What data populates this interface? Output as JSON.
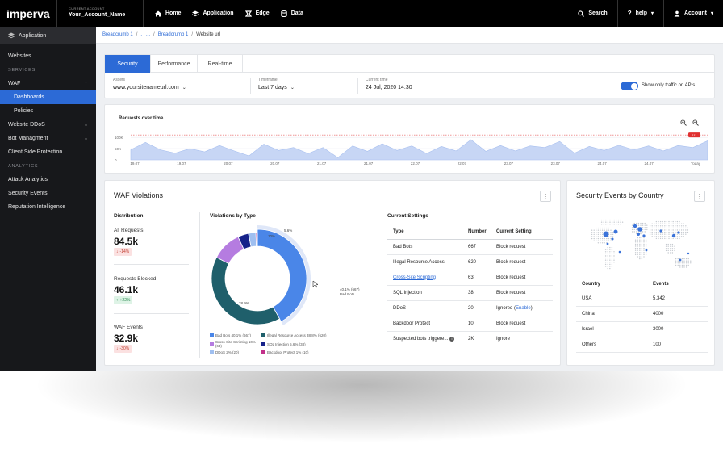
{
  "topbar": {
    "logo": "imperva",
    "account_label": "CURRENT ACCOUNT",
    "account_name": "Your_Account_Name",
    "nav": [
      {
        "label": "Home",
        "icon": "home-icon"
      },
      {
        "label": "Application",
        "icon": "layers-icon"
      },
      {
        "label": "Edge",
        "icon": "edge-icon"
      },
      {
        "label": "Data",
        "icon": "database-icon"
      }
    ],
    "search_label": "Search",
    "help_label": "help",
    "account_menu_label": "Account"
  },
  "sidebar": {
    "app_label": "Application",
    "websites": "Websites",
    "services_header": "SERVICES",
    "waf": "WAF",
    "dashboards": "Dashboards",
    "policies": "Policies",
    "website_ddos": "Website DDoS",
    "bot_management": "Bot Managment",
    "client_side": "Client Side Protection",
    "analytics_header": "ANALYTICS",
    "attack_analytics": "Attack Analytics",
    "security_events": "Security Events",
    "reputation": "Reputation Intelligence"
  },
  "breadcrumb": {
    "b1": "Breadcrumb 1",
    "b2": ". . . .",
    "b3": "Breadcrumb 1",
    "current": "Website url",
    "sep": "/"
  },
  "tabs": [
    "Security",
    "Performance",
    "Real-time"
  ],
  "filters": {
    "assets_label": "Assets",
    "assets_value": "www.yoursitenameurl.com",
    "timeframe_label": "Timeframe",
    "timeframe_value": "Last 7 days",
    "current_time_label": "Current time",
    "current_time_value": "24 Jul, 2020  14:30",
    "toggle_label": "Show only traffic on APIs"
  },
  "requests_chart": {
    "title": "Requests over time",
    "threshold_label": "111",
    "chart_data": {
      "type": "area",
      "title": "Requests over time",
      "x_ticks": [
        "19.07",
        "19.07",
        "20.07",
        "20.07",
        "21.07",
        "21.07",
        "22.07",
        "22.07",
        "23.07",
        "23.07",
        "24.07",
        "24.07",
        "Today"
      ],
      "y_ticks": [
        "100K",
        "50K",
        "0"
      ],
      "ylim": [
        0,
        115000
      ],
      "threshold": 111000,
      "values": [
        45000,
        78000,
        45000,
        30000,
        50000,
        36000,
        64000,
        40000,
        18000,
        70000,
        42000,
        55000,
        28000,
        55000,
        10000,
        62000,
        38000,
        72000,
        42000,
        62000,
        28000,
        60000,
        40000,
        90000,
        38000,
        64000,
        40000,
        62000,
        55000,
        82000,
        30000,
        60000,
        42000,
        65000,
        45000,
        62000,
        40000,
        64000,
        55000,
        85000
      ]
    }
  },
  "waf": {
    "title": "WAF Violations",
    "distribution_title": "Distribution",
    "all_requests_label": "All Requests",
    "all_requests_value": "84.5k",
    "all_requests_change": "-14%",
    "blocked_label": "Requests Blocked",
    "blocked_value": "46.1k",
    "blocked_change": "+22%",
    "events_label": "WAF Events",
    "events_value": "32.9k",
    "events_change": "-30%",
    "violations_title": "Violations by Type",
    "donut_labels": {
      "right": "40.1% (667)\nBad Bots",
      "left": "28.9%",
      "top_a": "10%",
      "top_b": "5.6%"
    },
    "chart_data": {
      "type": "pie",
      "labels": [
        "Bad Bots",
        "Illegal Resource Access",
        "Cross-Site Scripting",
        "SQL Injection",
        "DDoS",
        "Backdoor Protect"
      ],
      "values": [
        40.1,
        38.8,
        10,
        3.6,
        2.5,
        0.5
      ],
      "colors": [
        "#4a86e8",
        "#1f5f6b",
        "#b57ce0",
        "#16228a",
        "#9fbff0",
        "#c2308a"
      ]
    },
    "legend": [
      {
        "label": "Bad Bots 40.1% (667)",
        "color": "#4a86e8"
      },
      {
        "label": "Illegal Resource Access 38.8% (620)",
        "color": "#1f5f6b"
      },
      {
        "label": "Cross-Site Scripting 10% (63)",
        "color": "#b57ce0"
      },
      {
        "label": "SQL Injection 5.6% (38)",
        "color": "#16228a"
      },
      {
        "label": "DDoS 2% (20)",
        "color": "#9fbff0"
      },
      {
        "label": "Backdoor Protect 1% (10)",
        "color": "#c2308a"
      }
    ],
    "settings_title": "Current Settings",
    "settings_headers": [
      "Type",
      "Number",
      "Current Setting"
    ],
    "settings_rows": [
      {
        "type": "Bad Bots",
        "number": "667",
        "setting": "Block request"
      },
      {
        "type": "Illegal Resource Access",
        "number": "620",
        "setting": "Block request"
      },
      {
        "type": "Cross-Site Scripting",
        "number": "63",
        "setting": "Block request"
      },
      {
        "type": "SQL Injection",
        "number": "38",
        "setting": "Block request"
      },
      {
        "type": "DDoS",
        "number": "20",
        "setting": "Ignored (",
        "link": "Enable",
        "suffix": ")"
      },
      {
        "type": "Backdoor Protect",
        "number": "10",
        "setting": "Block request"
      },
      {
        "type": "Suspected bots triggere...",
        "number": "2K",
        "setting": "Ignore"
      }
    ]
  },
  "country": {
    "title": "Security Events by Country",
    "headers": [
      "Country",
      "Events"
    ],
    "rows": [
      {
        "country": "USA",
        "events": "5,342"
      },
      {
        "country": "China",
        "events": "4000"
      },
      {
        "country": "Israel",
        "events": "3000"
      },
      {
        "country": "Others",
        "events": "100"
      }
    ]
  },
  "colors": {
    "accent": "#2c6ad6",
    "topbar": "#000000",
    "sidebar": "#17181b",
    "area_fill": "#c7d6f5",
    "threshold": "#e03131"
  }
}
